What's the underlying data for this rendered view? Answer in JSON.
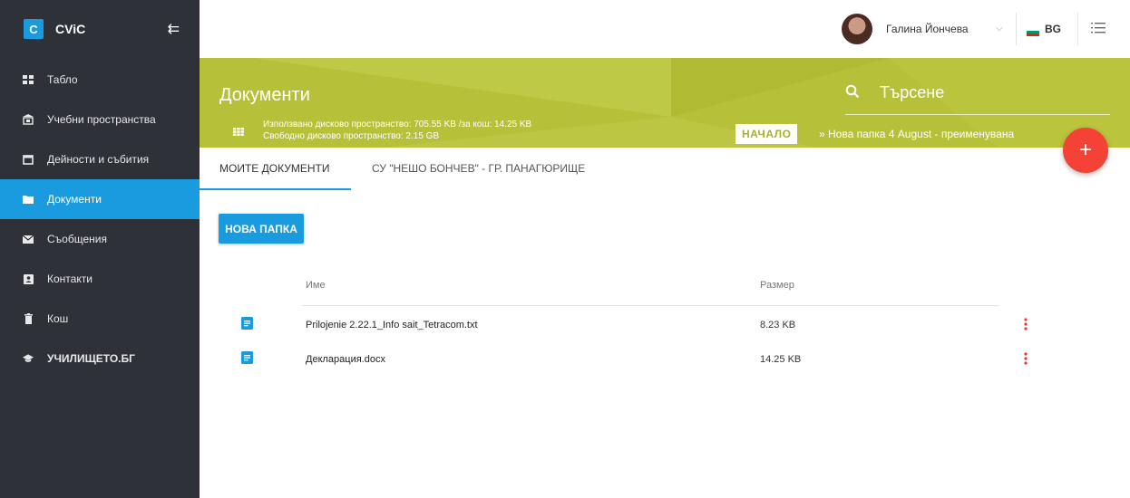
{
  "brand": {
    "badge": "C",
    "name": "CViC"
  },
  "sidebar": {
    "items": [
      {
        "label": "Табло",
        "icon": "dashboard-icon"
      },
      {
        "label": "Учебни пространства",
        "icon": "building-icon"
      },
      {
        "label": "Дейности и събития",
        "icon": "calendar-icon"
      },
      {
        "label": "Документи",
        "icon": "folder-icon",
        "active": true
      },
      {
        "label": "Съобщения",
        "icon": "mail-icon"
      },
      {
        "label": "Контакти",
        "icon": "contact-card-icon"
      },
      {
        "label": "Кош",
        "icon": "trash-icon"
      },
      {
        "label": "УЧИЛИЩЕТО.БГ",
        "icon": "graduation-cap-icon"
      }
    ]
  },
  "topbar": {
    "user_name": "Галина Йончева",
    "language": "BG"
  },
  "banner": {
    "title": "Документи",
    "usage_line1": "Използвано дисково пространство: 705.55 KB /за кош: 14.25 KB",
    "usage_line2": "Свободно дисково пространство: 2.15 GB",
    "search_placeholder": "Търсене",
    "breadcrumb_start": "НАЧАЛО",
    "breadcrumb_path": "» Нова папка 4 August - преименувана"
  },
  "tabs": [
    {
      "label": "МОИТЕ ДОКУМЕНТИ",
      "active": true
    },
    {
      "label": "СУ \"НЕШО БОНЧЕВ\" - ГР. ПАНАГЮРИЩЕ"
    }
  ],
  "actions": {
    "new_folder": "НОВА ПАПКА",
    "fab": "+"
  },
  "table": {
    "headers": {
      "name": "Име",
      "size": "Размер"
    },
    "rows": [
      {
        "name": "Prilojenie 2.22.1_Info sait_Tetracom.txt",
        "size": "8.23 KB"
      },
      {
        "name": "Декларация.docx",
        "size": "14.25 KB"
      }
    ]
  },
  "colors": {
    "accent": "#1a9be0",
    "banner": "#b6c139",
    "sidebar": "#2e3138",
    "fab": "#f44336",
    "kebab": "#e53935"
  }
}
